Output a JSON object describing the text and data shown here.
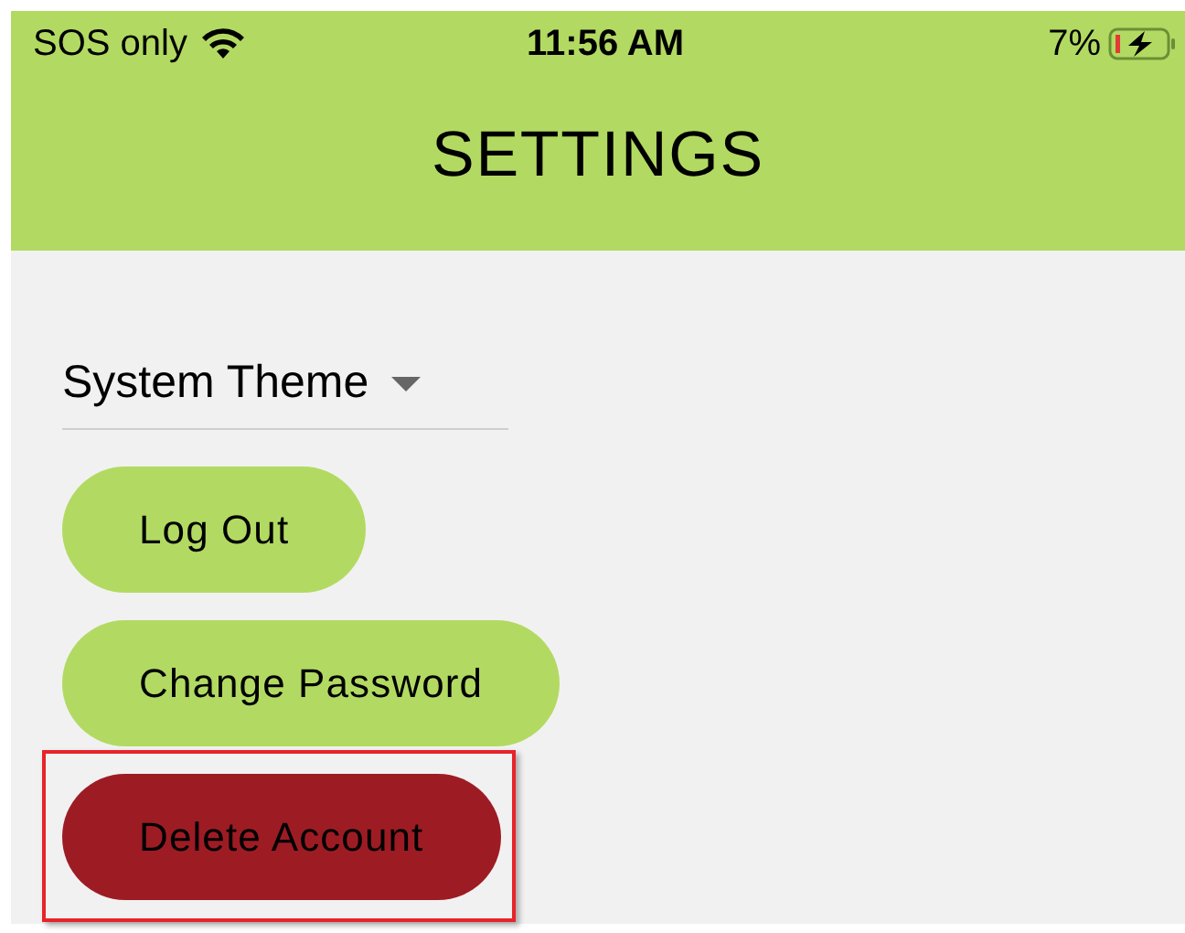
{
  "status_bar": {
    "carrier": "SOS only",
    "time": "11:56 AM",
    "battery": "7%"
  },
  "header": {
    "title": "SETTINGS"
  },
  "theme_dropdown": {
    "value": "System Theme"
  },
  "buttons": [
    {
      "label": "Log Out",
      "kind": "primary",
      "highlighted": false
    },
    {
      "label": "Change Password",
      "kind": "primary",
      "highlighted": false
    },
    {
      "label": "Delete Account",
      "kind": "danger",
      "highlighted": true
    }
  ]
}
